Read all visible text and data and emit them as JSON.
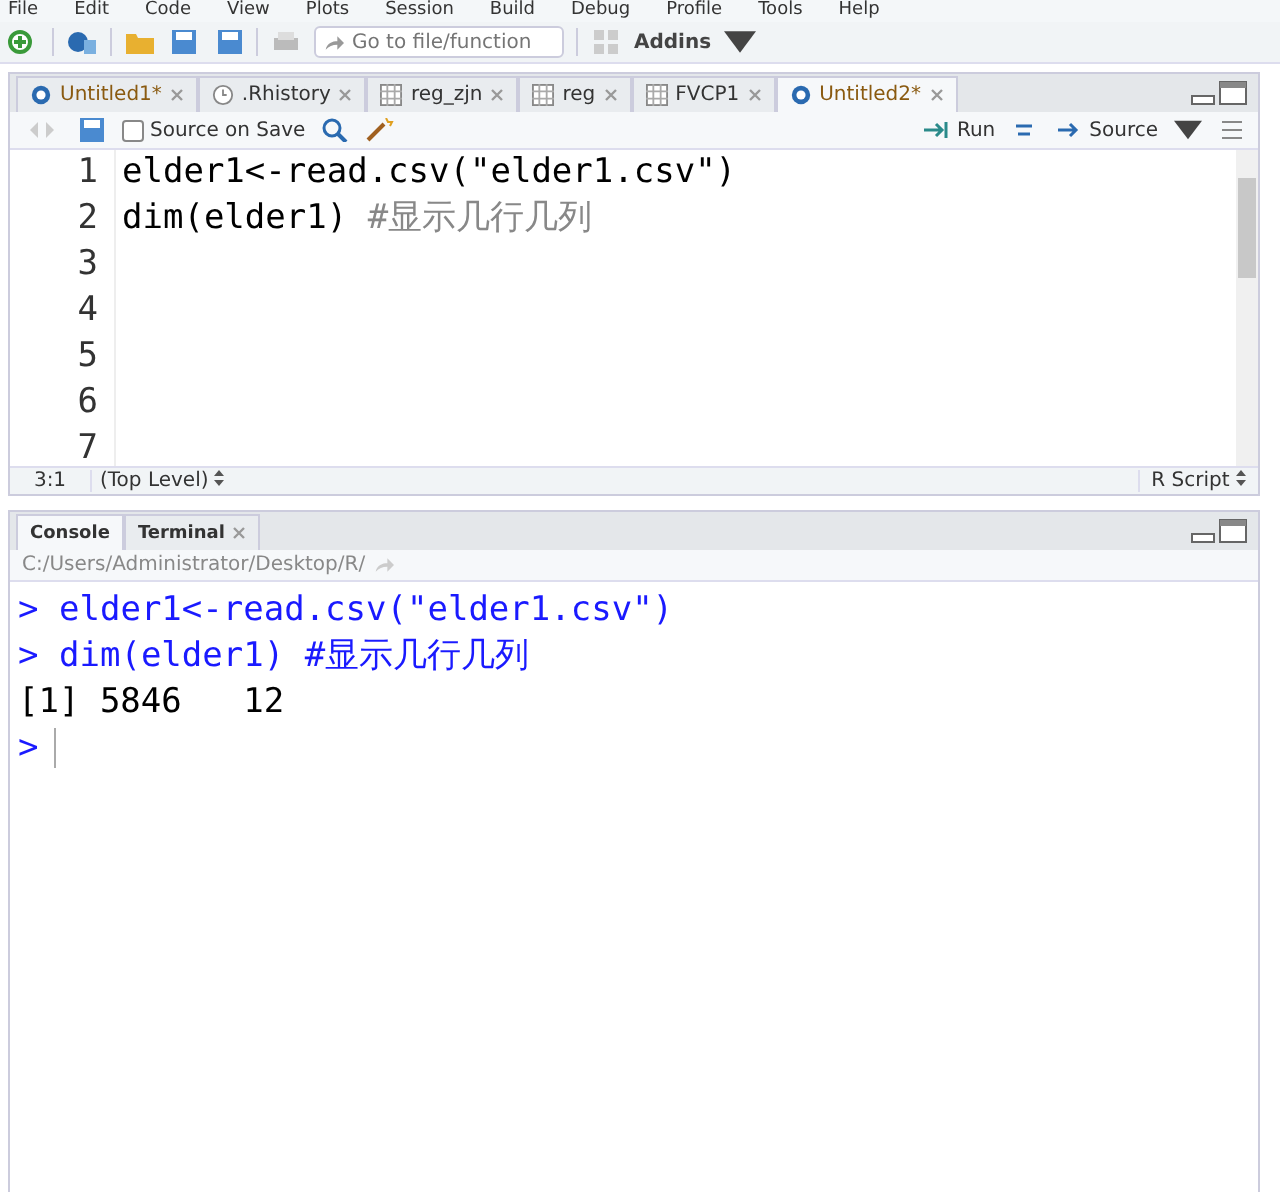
{
  "menu": [
    "File",
    "Edit",
    "Code",
    "View",
    "Plots",
    "Session",
    "Build",
    "Debug",
    "Profile",
    "Tools",
    "Help"
  ],
  "toolbar": {
    "goto_placeholder": "Go to file/function",
    "addins": "Addins"
  },
  "editor": {
    "tabs": [
      {
        "label": "Untitled1*",
        "kind": "script",
        "modified": true,
        "selected": false
      },
      {
        "label": ".Rhistory",
        "kind": "history",
        "modified": false,
        "selected": false
      },
      {
        "label": "reg_zjn",
        "kind": "data",
        "modified": false,
        "selected": false
      },
      {
        "label": "reg",
        "kind": "data",
        "modified": false,
        "selected": false
      },
      {
        "label": "FVCP1",
        "kind": "data",
        "modified": false,
        "selected": false
      },
      {
        "label": "Untitled2*",
        "kind": "script",
        "modified": true,
        "selected": true
      }
    ],
    "source_on_save": {
      "label": "Source on Save",
      "checked": false
    },
    "run": "Run",
    "source": "Source",
    "lines": [
      {
        "number": "1",
        "segments": [
          {
            "kind": "code",
            "text": "elder1<-read.csv(\"elder1.csv\")"
          }
        ]
      },
      {
        "number": "2",
        "segments": [
          {
            "kind": "code",
            "text": "dim(elder1) "
          },
          {
            "kind": "comment",
            "text": "#显示几行几列"
          }
        ]
      },
      {
        "number": "3"
      },
      {
        "number": "4"
      },
      {
        "number": "5"
      },
      {
        "number": "6"
      },
      {
        "number": "7"
      }
    ],
    "status": {
      "position": "3:1",
      "scope": "(Top Level)",
      "filetype": "R Script"
    }
  },
  "console": {
    "tabs": [
      {
        "label": "Console",
        "closable": false,
        "selected": true
      },
      {
        "label": "Terminal",
        "closable": true,
        "selected": false
      }
    ],
    "path": "C:/Users/Administrator/Desktop/R/",
    "lines": [
      {
        "kind": "input",
        "prompt": ">",
        "text": "elder1<-read.csv(\"elder1.csv\")"
      },
      {
        "kind": "input",
        "prompt": ">",
        "text": "dim(elder1) #显示几行几列"
      },
      {
        "kind": "output",
        "text": "[1] 5846   12"
      },
      {
        "kind": "cursor",
        "prompt": ">"
      }
    ]
  }
}
